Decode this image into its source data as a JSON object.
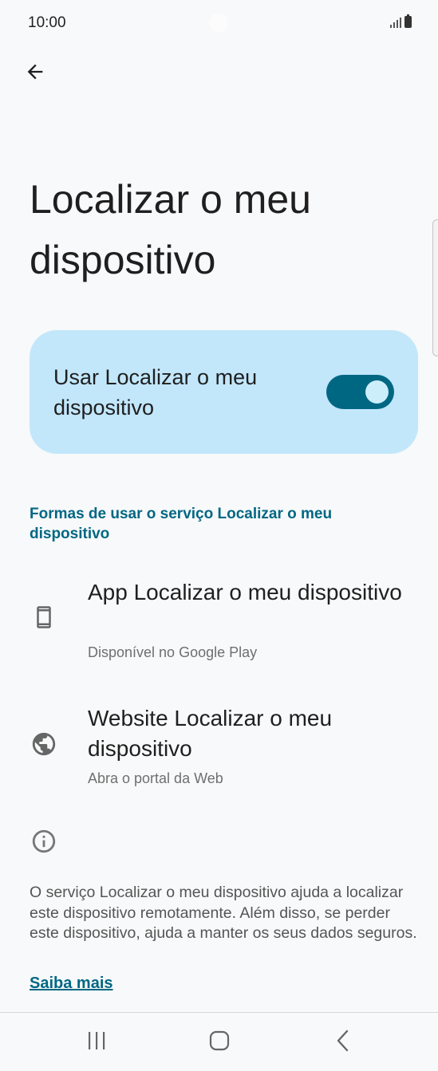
{
  "status_bar": {
    "time": "10:00"
  },
  "page": {
    "title": "Localizar o meu dispositivo"
  },
  "main_toggle": {
    "label": "Usar Localizar o meu dispositivo",
    "state": "on"
  },
  "section": {
    "header": "Formas de usar o serviço Localizar o meu dispositivo"
  },
  "items": [
    {
      "title": "App Localizar o meu dispositivo",
      "summary": "Disponível no Google Play",
      "icon": "phone-icon"
    },
    {
      "title": "Website Localizar o meu dispositivo",
      "summary": "Abra o portal da Web",
      "icon": "globe-icon"
    }
  ],
  "info": {
    "text": "O serviço Localizar o meu dispositivo ajuda a localizar este dispositivo remotamente. Além disso, se perder este dispositivo, ajuda a manter os seus dados seguros.",
    "link": "Saiba mais"
  },
  "colors": {
    "accent": "#006783",
    "card": "#c2e7fb",
    "background": "#f8f9fa"
  },
  "nav_bar": {
    "icons": [
      "recents-icon",
      "home-icon",
      "back-nav-icon"
    ]
  }
}
